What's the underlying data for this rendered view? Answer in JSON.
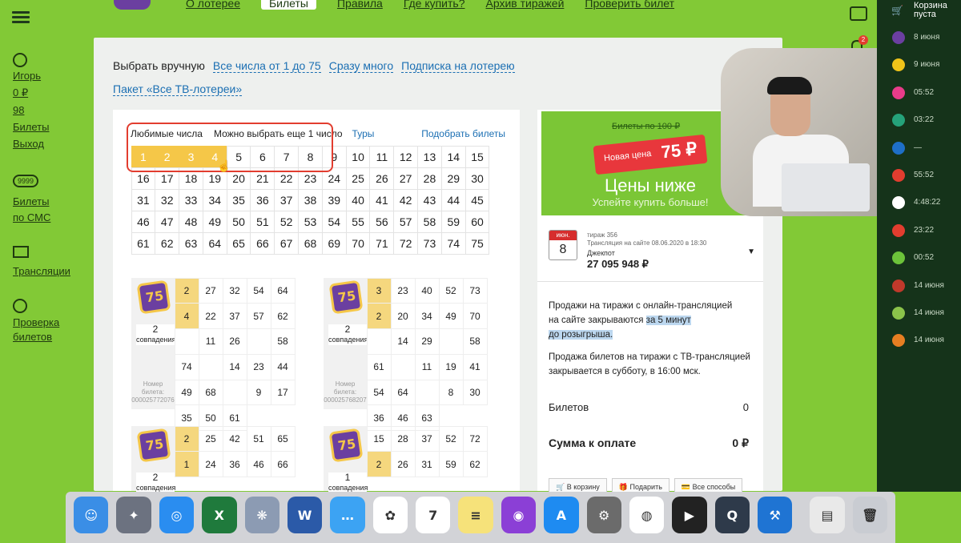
{
  "topnav": {
    "links": [
      "О лотерее",
      "Билеты",
      "Правила",
      "Где купить?",
      "Архив тиражей",
      "Проверить билет"
    ],
    "active_index": 1
  },
  "left_sidebar": {
    "user_name": "Игорь",
    "balance": "0 ₽",
    "bonus": "98",
    "tickets": "Билеты",
    "logout": "Выход",
    "sms_badge": "9999",
    "sms_label_1": "Билеты",
    "sms_label_2": "по СМС",
    "broadcasts": "Трансляции",
    "check_1": "Проверка",
    "check_2": "билетов"
  },
  "main": {
    "select_tabs": {
      "manual": "Выбрать вручную",
      "all_numbers": "Все числа от 1 до 75",
      "many": "Сразу много",
      "subscription": "Подписка на лотерею"
    },
    "package": "Пакет «Все ТВ-лотереи»",
    "picker": {
      "favorites": "Любимые числа",
      "can_choose": "Можно выбрать еще 1 число",
      "tours": "Туры",
      "pick_tickets": "Подобрать билеты",
      "selected": [
        1,
        2,
        3,
        4
      ],
      "numbers": [
        1,
        2,
        3,
        4,
        5,
        6,
        7,
        8,
        9,
        10,
        11,
        12,
        13,
        14,
        15,
        16,
        17,
        18,
        19,
        20,
        21,
        22,
        23,
        24,
        25,
        26,
        27,
        28,
        29,
        30,
        31,
        32,
        33,
        34,
        35,
        36,
        37,
        38,
        39,
        40,
        41,
        42,
        43,
        44,
        45,
        46,
        47,
        48,
        49,
        50,
        51,
        52,
        53,
        54,
        55,
        56,
        57,
        58,
        59,
        60,
        61,
        62,
        63,
        64,
        65,
        66,
        67,
        68,
        69,
        70,
        71,
        72,
        73,
        74,
        75
      ]
    },
    "tickets": [
      {
        "matches": "2",
        "matches_label": "совпадения",
        "number_label": "Номер билета:",
        "number": "000025772076",
        "cells": [
          "2",
          "27",
          "32",
          "54",
          "64",
          "4",
          "22",
          "37",
          "57",
          "62",
          "",
          "11",
          "26",
          "",
          "58",
          "74",
          "",
          "14",
          "23",
          "44",
          "49",
          "68",
          "",
          "9",
          "17",
          "35",
          "50",
          "61"
        ],
        "hits": [
          0,
          5
        ]
      },
      {
        "matches": "2",
        "matches_label": "совпадения",
        "number_label": "Номер билета:",
        "number": "000025768207",
        "cells": [
          "3",
          "23",
          "40",
          "52",
          "73",
          "2",
          "20",
          "34",
          "49",
          "70",
          "",
          "14",
          "29",
          "",
          "58",
          "61",
          "",
          "11",
          "19",
          "41",
          "54",
          "64",
          "",
          "8",
          "30",
          "36",
          "46",
          "63"
        ],
        "hits": [
          0,
          5
        ]
      },
      {
        "matches": "2",
        "matches_label": "совпадения",
        "cells": [
          "2",
          "25",
          "42",
          "51",
          "65",
          "1",
          "24",
          "36",
          "46",
          "66"
        ],
        "hits": [
          0,
          5
        ]
      },
      {
        "matches": "1",
        "matches_label": "совпадения",
        "cells": [
          "15",
          "28",
          "37",
          "52",
          "72",
          "2",
          "26",
          "31",
          "59",
          "62"
        ],
        "hits": [
          5
        ]
      }
    ]
  },
  "right_panel": {
    "promo": {
      "old_price": "Билеты по 100 ₽",
      "new_label": "Новая цена",
      "new_price": "75 ₽",
      "headline": "Цены ниже",
      "sub": "Успейте купить больше!"
    },
    "draw": {
      "month": "июн.",
      "day": "8",
      "draw_no": "тираж 356",
      "broadcast": "Трансляция на сайте 08.06.2020 в 18:30",
      "jackpot_label": "Джекпот",
      "jackpot": "27 095 948 ₽"
    },
    "note1_a": "Продажи на тиражи с онлайн-трансляцией",
    "note1_b": "на сайте закрываются ",
    "note1_hl": "за 5 минут",
    "note1_c": "до розыгрыша.",
    "note2": "Продажа билетов на тиражи с ТВ-трансляцией закрывается в субботу, в 16:00 мск.",
    "tickets_label": "Билетов",
    "tickets_count": "0",
    "sum_label": "Сумма к оплате",
    "sum_value": "0 ₽",
    "btn_cart": "В корзину",
    "btn_gift": "Подарить",
    "btn_other": "Все способы"
  },
  "header_icons": {
    "notif_count": "2"
  },
  "right_sidebar": {
    "cart_1": "Корзина",
    "cart_2": "пуста",
    "items": [
      {
        "time": "8 июня",
        "color": "#6b3fa0"
      },
      {
        "time": "9 июня",
        "color": "#f0c419"
      },
      {
        "time": "05:52",
        "color": "#e83c8a"
      },
      {
        "time": "03:22",
        "color": "#25a27a"
      },
      {
        "time": "—",
        "color": "#1e6fc7"
      },
      {
        "time": "55:52",
        "color": "#e23d2f"
      },
      {
        "time": "4:48:22",
        "color": "#ffffff"
      },
      {
        "time": "23:22",
        "color": "#e23d2f"
      },
      {
        "time": "00:52",
        "color": "#6cc33a"
      },
      {
        "time": "14 июня",
        "color": "#c0392b"
      },
      {
        "time": "14 июня",
        "color": "#8bc34a"
      },
      {
        "time": "14 июня",
        "color": "#e67e22"
      }
    ]
  },
  "dock": {
    "apps": [
      {
        "name": "finder",
        "color": "#3a8ee6",
        "glyph": "☺"
      },
      {
        "name": "launchpad",
        "color": "#6c7280",
        "glyph": "✦"
      },
      {
        "name": "safari",
        "color": "#2a8df0",
        "glyph": "◎"
      },
      {
        "name": "excel",
        "color": "#1f7a3c",
        "glyph": "X"
      },
      {
        "name": "preview",
        "color": "#8c9bb3",
        "glyph": "❋"
      },
      {
        "name": "word",
        "color": "#2b5aa8",
        "glyph": "W"
      },
      {
        "name": "messages",
        "color": "#3ca3f3",
        "glyph": "…"
      },
      {
        "name": "photos",
        "color": "#ffffff",
        "glyph": "✿"
      },
      {
        "name": "calendar",
        "color": "#ffffff",
        "glyph": "7"
      },
      {
        "name": "notes",
        "color": "#f6e27a",
        "glyph": "≡"
      },
      {
        "name": "podcasts",
        "color": "#8b3fd6",
        "glyph": "◉"
      },
      {
        "name": "app-store",
        "color": "#1e8bf1",
        "glyph": "A"
      },
      {
        "name": "system-preferences",
        "color": "#6b6b6b",
        "glyph": "⚙"
      },
      {
        "name": "chrome",
        "color": "#ffffff",
        "glyph": "◍"
      },
      {
        "name": "final-cut",
        "color": "#222222",
        "glyph": "▶"
      },
      {
        "name": "quicktime",
        "color": "#2e3a4a",
        "glyph": "Q"
      },
      {
        "name": "xcode",
        "color": "#1f74d3",
        "glyph": "⚒"
      },
      {
        "name": "downloads-stack",
        "color": "#e9e9e9",
        "glyph": "▤"
      },
      {
        "name": "trash",
        "color": "#c9ccd2",
        "glyph": "🗑"
      }
    ]
  }
}
